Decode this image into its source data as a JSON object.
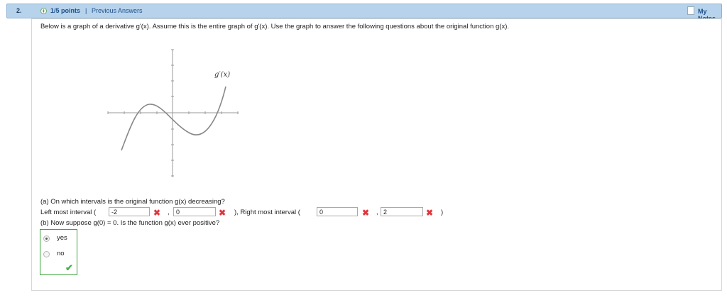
{
  "header": {
    "question_number": "2.",
    "points": "1/5 points",
    "separator": "|",
    "previous_answers": "Previous Answers",
    "my_notes": "My Notes"
  },
  "question": {
    "intro": "Below is a graph of a derivative g'(x). Assume this is the entire graph of g'(x). Use the graph to answer the following questions about the original function g(x).",
    "graph_label": "g′(x)",
    "part_a": {
      "prompt": "(a) On which intervals is the original function g(x) decreasing?",
      "left_label": "Left most interval (",
      "left_start": "-2",
      "left_end": "0",
      "mid_label": "), Right most interval (",
      "right_start": "0",
      "right_end": "2",
      "comma": ",",
      "close": ")"
    },
    "part_b": {
      "prompt": "(b) Now suppose g(0) = 0. Is the function g(x) ever positive?",
      "options": [
        "yes",
        "no"
      ],
      "selected": "yes"
    }
  },
  "colors": {
    "header_bg": "#b7d3eb",
    "link": "#1d4f8a",
    "wrong": "#e0373e",
    "correct": "#4cb04c"
  }
}
